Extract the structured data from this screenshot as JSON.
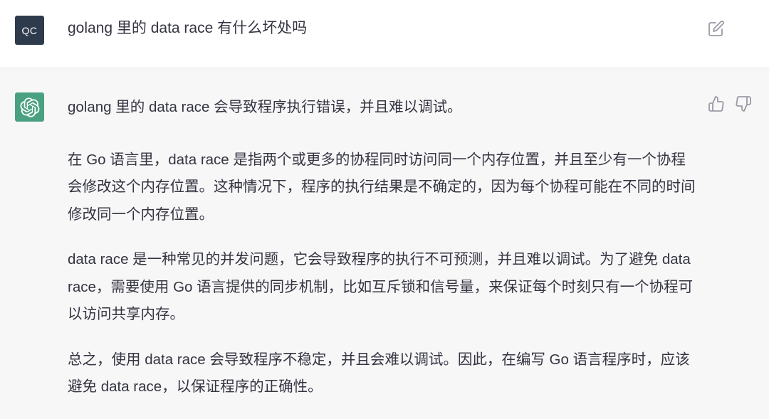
{
  "user_message": {
    "avatar_initials": "QC",
    "text": "golang 里的 data race 有什么坏处吗",
    "edit_icon": "edit-icon"
  },
  "assistant_message": {
    "avatar_icon": "openai-logo-icon",
    "feedback_icons": [
      "thumbs-up-icon",
      "thumbs-down-icon"
    ],
    "paragraphs": [
      "golang 里的 data race 会导致程序执行错误，并且难以调试。",
      "在 Go 语言里，data race 是指两个或更多的协程同时访问同一个内存位置，并且至少有一个协程会修改这个内存位置。这种情况下，程序的执行结果是不确定的，因为每个协程可能在不同的时间修改同一个内存位置。",
      "data race 是一种常见的并发问题，它会导致程序的执行不可预测，并且难以调试。为了避免 data race，需要使用 Go 语言提供的同步机制，比如互斥锁和信号量，来保证每个时刻只有一个协程可以访问共享内存。",
      "总之，使用 data race 会导致程序不稳定，并且会难以调试。因此，在编写 Go 语言程序时，应该避免 data race，以保证程序的正确性。"
    ]
  },
  "colors": {
    "user_avatar_bg": "#2e3b4c",
    "bot_avatar_bg": "#4aa181",
    "assistant_row_bg": "#f7f7f8",
    "text": "#343541",
    "icon": "#9a9aa6"
  }
}
